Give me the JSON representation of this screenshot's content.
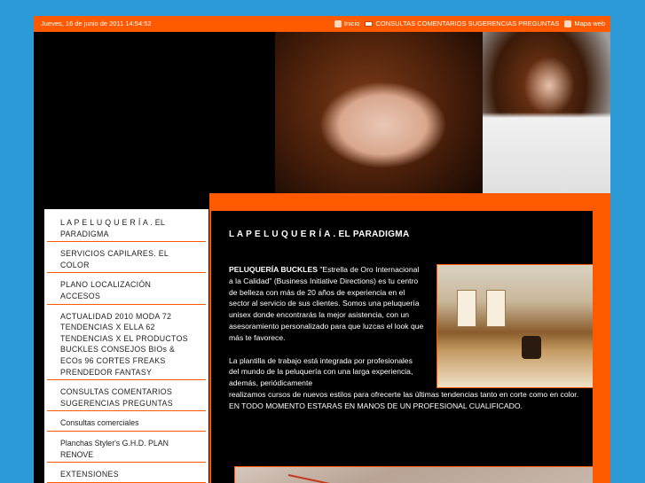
{
  "topbar": {
    "date": "Jueves, 16 de junio de 2011 14:54:52",
    "links": [
      {
        "label": "Inicio",
        "icon": "home-icon"
      },
      {
        "label": "CONSULTAS COMENTARIOS SUGERENCIAS PREGUNTAS",
        "icon": "envelope-icon"
      },
      {
        "label": "Mapa web",
        "icon": "sitemap-icon"
      }
    ]
  },
  "sidebar": {
    "items": [
      {
        "label": "L A P E L U Q U E R Í A . EL PARADIGMA"
      },
      {
        "label": "SERVICIOS CAPILARES. EL COLOR"
      },
      {
        "label": "PLANO LOCALIZACIÓN ACCESOS"
      },
      {
        "label": "ACTUALIDAD 2010 MODA 72 TENDENCIAS X ELLA 62 TENDENCIAS X EL PRODUCTOS BUCKLES CONSEJOS BIOs & ECOs 96 CORTES FREAKS PRENDEDOR FANTASY"
      },
      {
        "label": "CONSULTAS COMENTARIOS SUGERENCIAS PREGUNTAS"
      },
      {
        "label": "Consultas comerciales"
      },
      {
        "label": "Planchas Styler's G.H.D. PLAN RENOVE"
      },
      {
        "label": "EXTENSIONES"
      }
    ]
  },
  "content": {
    "title": "L A P E L U Q U E R Í A . EL PARADIGMA",
    "p1_bold": "PELUQUERÍA BUCKLES",
    "p1_rest": " \"Estrella de Oro Internacional a la Calidad\" (Business Initiative Directions) es tu centro de belleza con más de 20 años de experiencia en el sector al servicio de sus clientes. Somos una peluquería unisex donde encontrarás la mejor asistencia, con un asesoramiento personalizado para que luzcas el look que más te favorece.",
    "p2_a": "La plantilla de trabajo está integrada por profesionales del mundo de la peluquería con una larga experiencia, además, periódicamente",
    "p2_b": "realizamos cursos de nuevos estilos para ofrecerte las últimas tendencias tanto en corte como en color.",
    "p3": "EN TODO MOMENTO ESTARAS EN MANOS DE UN PROFESIONAL CUALIFICADO."
  },
  "colors": {
    "background": "#2b9ad6",
    "accent": "#ff5a00",
    "page": "#000000",
    "sidebar": "#ffffff"
  }
}
